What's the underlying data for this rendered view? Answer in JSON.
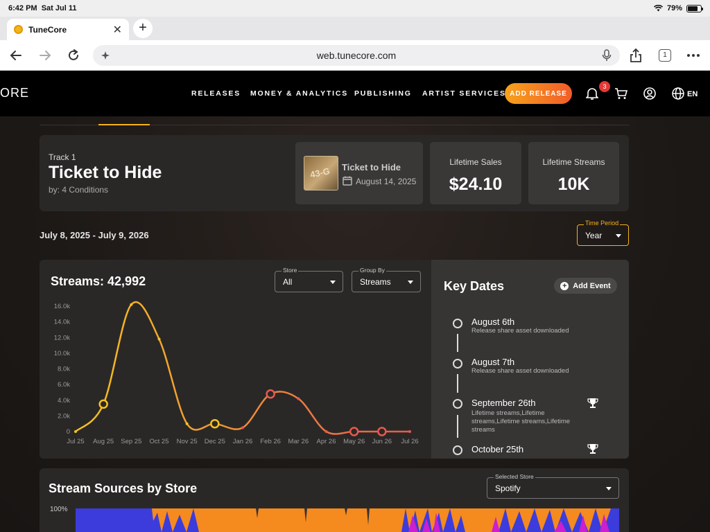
{
  "status_bar": {
    "time": "6:42 PM",
    "date": "Sat Jul 11",
    "battery": "79%",
    "battery_level": 0.79
  },
  "browser": {
    "tab_title": "TuneCore",
    "url": "web.tunecore.com",
    "tab_count": "1"
  },
  "nav": {
    "logo": "ORE",
    "links": [
      "RELEASES",
      "MONEY & ANALYTICS",
      "PUBLISHING",
      "ARTIST SERVICES"
    ],
    "add_release": "ADD RELEASE",
    "notification_count": "3",
    "language": "EN",
    "colors": {
      "accent_start": "#f7a21b",
      "accent_end": "#f25c2a"
    }
  },
  "track": {
    "number": "Track 1",
    "title": "Ticket to Hide",
    "by": "by: 4 Conditions",
    "release_title": "Ticket to Hide",
    "release_date": "August 14, 2025",
    "cover_text": "43-G",
    "lifetime_sales_label": "Lifetime Sales",
    "lifetime_sales": "$24.10",
    "lifetime_streams_label": "Lifetime Streams",
    "lifetime_streams": "10K"
  },
  "filters": {
    "date_range": "July 8, 2025 - July 9, 2026",
    "time_period_label": "Time Period",
    "time_period": "Year",
    "store_label": "Store",
    "store": "All",
    "group_by_label": "Group By",
    "group_by": "Streams"
  },
  "streams_title": "Streams: 42,992",
  "chart_data": {
    "type": "line",
    "title": "Streams: 42,992",
    "x": [
      "Jul 25",
      "Aug 25",
      "Sep 25",
      "Oct 25",
      "Nov 25",
      "Dec 25",
      "Jan 26",
      "Feb 26",
      "Mar 26",
      "Apr 26",
      "May 26",
      "Jun 26",
      "Jul 26"
    ],
    "y_ticks": [
      "0",
      "2.0k",
      "4.0k",
      "6.0k",
      "8.0k",
      "10.0k",
      "12.0k",
      "14.0k",
      "16.0k"
    ],
    "ylim": [
      0,
      16000
    ],
    "values": [
      0,
      3500,
      16200,
      11800,
      1000,
      1000,
      500,
      4800,
      4200,
      0,
      0,
      0,
      0
    ],
    "highlighted_points": [
      "Aug 25",
      "Dec 25",
      "Feb 26",
      "May 26",
      "Jun 26"
    ],
    "grid": false,
    "gradient_colors": [
      "#f7c21e",
      "#e85a4f"
    ]
  },
  "key_dates": {
    "title": "Key Dates",
    "add_event": "Add Event",
    "events": [
      {
        "date": "August 6th",
        "desc": "Release share asset downloaded",
        "trophy": false
      },
      {
        "date": "August 7th",
        "desc": "Release share asset downloaded",
        "trophy": false
      },
      {
        "date": "September 26th",
        "desc": "Lifetime streams,Lifetime streams,Lifetime streams,Lifetime streams",
        "trophy": true
      },
      {
        "date": "October 25th",
        "desc": "",
        "trophy": true
      }
    ]
  },
  "sources": {
    "title": "Stream Sources by Store",
    "selected_store_label": "Selected Store",
    "selected_store": "Spotify",
    "pct_label": "100%"
  }
}
